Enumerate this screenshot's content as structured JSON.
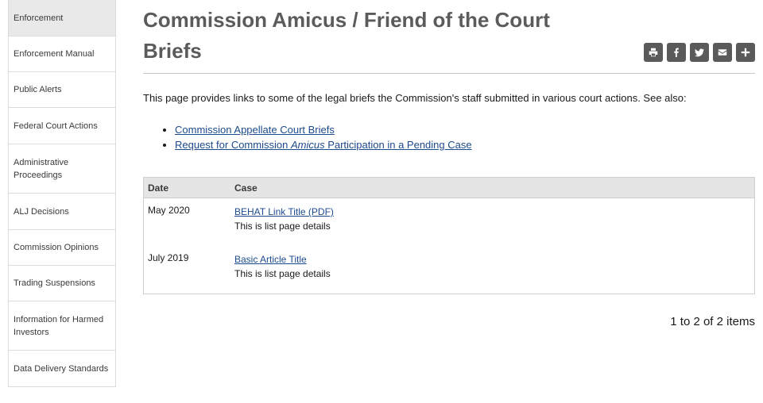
{
  "sidebar": {
    "items": [
      {
        "label": "Enforcement",
        "active": true
      },
      {
        "label": "Enforcement Manual"
      },
      {
        "label": "Public Alerts"
      },
      {
        "label": "Federal Court Actions"
      },
      {
        "label": "Administrative Proceedings"
      },
      {
        "label": "ALJ Decisions"
      },
      {
        "label": "Commission Opinions"
      },
      {
        "label": "Trading Suspensions"
      },
      {
        "label": "Information for Harmed Investors"
      },
      {
        "label": "Data Delivery Standards"
      }
    ]
  },
  "page": {
    "title": "Commission Amicus / Friend of the Court Briefs",
    "intro": "This page provides links to some of the legal briefs the Commission's staff submitted in various court actions. See also:",
    "links": {
      "appellate": "Commission Appellate Court Briefs",
      "request_pre": "Request for Commission ",
      "request_em": "Amicus",
      "request_post": " Participation in a Pending Case"
    }
  },
  "share": {
    "icons": [
      "print-icon",
      "facebook-icon",
      "twitter-icon",
      "email-icon",
      "plus-icon"
    ]
  },
  "table": {
    "headers": {
      "date": "Date",
      "case": "Case"
    },
    "rows": [
      {
        "date": "May 2020",
        "link": "BEHAT Link Title (PDF)",
        "details": "This is list page details"
      },
      {
        "date": "July 2019",
        "link": "Basic Article Title",
        "details": "This is list page details"
      }
    ]
  },
  "pager": {
    "text": "1 to 2 of 2 items"
  },
  "colors": {
    "link": "#1c4a8c",
    "share_bg": "#5a5a5a",
    "sidebar_active": "#e9e9e9"
  }
}
